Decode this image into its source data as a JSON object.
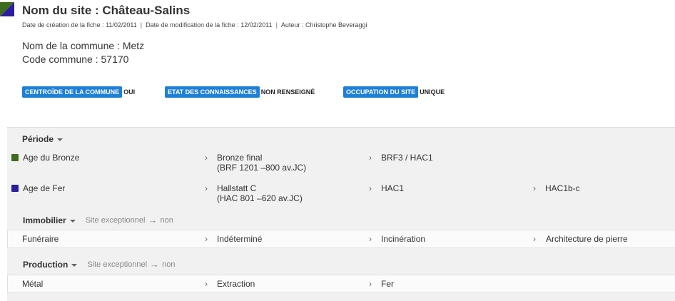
{
  "header": {
    "title": "Nom du site : Château-Salins",
    "created": "Date de création de la fiche : 11/02/2011",
    "modified": "Date de modification de la fiche : 12/02/2011",
    "author": "Auteur : Christophe Beveraggi",
    "separator": "|"
  },
  "commune": {
    "name": "Nom de la commune : Metz",
    "code": "Code commune : 57170"
  },
  "tags": [
    {
      "label": "CENTROÏDE DE LA COMMUNE",
      "value": "OUI"
    },
    {
      "label": "ETAT DES CONNAISSANCES",
      "value": "NON RENSEIGNÉ"
    },
    {
      "label": "OCCUPATION DU SITE",
      "value": "UNIQUE"
    }
  ],
  "colors": {
    "accent": "#1e7fd6",
    "bronze": "#3f6b1f",
    "fer": "#2b1fa0"
  },
  "periode": {
    "heading": "Période",
    "rows": [
      {
        "name": "Age du Bronze",
        "col2_line1": "Bronze final",
        "col2_line2": "(BRF 1201 –800 av.JC)",
        "col3": "BRF3 / HAC1",
        "col4": ""
      },
      {
        "name": "Age de Fer",
        "col2_line1": "Hallstatt C",
        "col2_line2": "(HAC 801 –620 av.JC)",
        "col3": "HAC1",
        "col4": "HAC1b-c"
      }
    ]
  },
  "immobilier": {
    "heading": "Immobilier",
    "exceptional_label": "Site exceptionnel",
    "exceptional_arrow": "→",
    "exceptional_value": "non",
    "row": {
      "c1": "Funéraire",
      "c2": "Indéterminé",
      "c3": "Incinération",
      "c4": "Architecture de pierre"
    }
  },
  "production": {
    "heading": "Production",
    "exceptional_label": "Site exceptionnel",
    "exceptional_arrow": "→",
    "exceptional_value": "non",
    "row": {
      "c1": "Métal",
      "c2": "Extraction",
      "c3": "Fer"
    }
  },
  "chevron": "›"
}
